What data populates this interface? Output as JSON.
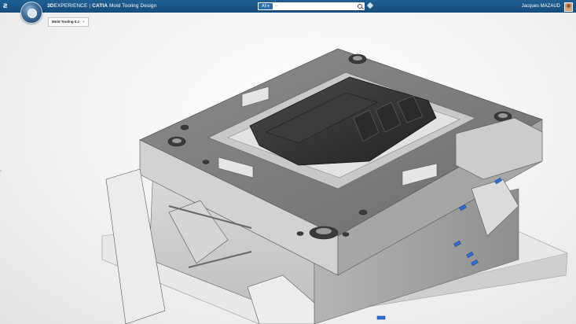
{
  "header": {
    "brand_3d": "3D",
    "brand_experience": "EXPERIENCE",
    "separator": "|",
    "brand_catia": "CATIA",
    "app_name": "Mold Tooling Design",
    "search": {
      "scope": "All",
      "placeholder": "--"
    },
    "user_name": "Jacques MAZAUD"
  },
  "tabs": [
    {
      "label": "Mold Tooling 0.1",
      "close": "×"
    }
  ],
  "viewport": {
    "model": "injection-mold-assembly"
  },
  "colors": {
    "topbar": "#1a5586",
    "plate": "#9c9c9c",
    "core": "#2f2f2f",
    "accent_connector": "#2f6fd0"
  }
}
